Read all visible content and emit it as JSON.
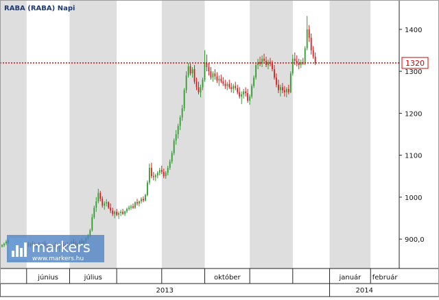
{
  "header": {
    "symbol": "RABA (RABA)",
    "period": "Napi"
  },
  "watermark": {
    "brand": "markers",
    "url": "www.markers.hu"
  },
  "current_price_label": "1320",
  "colors": {
    "up": "#2c9b2c",
    "down": "#d11c1c",
    "price_line": "#dd0000",
    "stripe": "#dedede",
    "axis": "#222222",
    "title": "#1f3b6e",
    "watermark_bg": "#4f82c4"
  },
  "chart_data": {
    "type": "candlestick",
    "title": "RABA (RABA)  Napi",
    "x_unit": "trading day index",
    "y_ticks": [
      {
        "value": 900,
        "label": "900,0"
      },
      {
        "value": 1000,
        "label": "1000"
      },
      {
        "value": 1100,
        "label": "1100"
      },
      {
        "value": 1200,
        "label": "1200"
      },
      {
        "value": 1300,
        "label": "1300"
      },
      {
        "value": 1400,
        "label": "1400"
      }
    ],
    "ylim": [
      830,
      1470
    ],
    "xlim": [
      0,
      195
    ],
    "current_price": 1320,
    "months": [
      {
        "label": "",
        "start": 0
      },
      {
        "label": "június",
        "start": 13
      },
      {
        "label": "július",
        "start": 34
      },
      {
        "label": "",
        "start": 57
      },
      {
        "label": "",
        "start": 79
      },
      {
        "label": "október",
        "start": 100
      },
      {
        "label": "",
        "start": 122
      },
      {
        "label": "",
        "start": 143
      },
      {
        "label": "január",
        "start": 161
      },
      {
        "label": "február",
        "start": 181
      }
    ],
    "years": [
      {
        "label": "2013",
        "start": 0
      },
      {
        "label": "2014",
        "start": 161
      }
    ],
    "ohlc": [
      [
        0,
        880,
        883,
        876,
        878
      ],
      [
        1,
        882,
        888,
        880,
        886
      ],
      [
        2,
        885,
        892,
        881,
        889
      ],
      [
        3,
        890,
        898,
        886,
        894
      ],
      [
        4,
        893,
        899,
        889,
        896
      ],
      [
        5,
        896,
        900,
        889,
        892
      ],
      [
        6,
        890,
        895,
        886,
        893
      ],
      [
        7,
        891,
        899,
        888,
        896
      ],
      [
        8,
        897,
        903,
        893,
        898
      ],
      [
        9,
        898,
        901,
        891,
        894
      ],
      [
        10,
        894,
        898,
        888,
        891
      ],
      [
        11,
        892,
        899,
        888,
        895
      ],
      [
        12,
        897,
        901,
        890,
        892
      ],
      [
        13,
        892,
        897,
        886,
        890
      ],
      [
        14,
        888,
        894,
        881,
        884
      ],
      [
        15,
        884,
        892,
        880,
        889
      ],
      [
        16,
        890,
        895,
        884,
        886
      ],
      [
        17,
        886,
        892,
        880,
        883
      ],
      [
        18,
        882,
        890,
        878,
        888
      ],
      [
        19,
        889,
        893,
        882,
        884
      ],
      [
        20,
        885,
        891,
        879,
        887
      ],
      [
        21,
        886,
        894,
        881,
        891
      ],
      [
        22,
        890,
        896,
        883,
        885
      ],
      [
        23,
        884,
        890,
        876,
        879
      ],
      [
        24,
        879,
        886,
        872,
        883
      ],
      [
        25,
        884,
        889,
        878,
        880
      ],
      [
        26,
        880,
        887,
        873,
        885
      ],
      [
        27,
        886,
        892,
        880,
        882
      ],
      [
        28,
        882,
        888,
        874,
        877
      ],
      [
        29,
        877,
        884,
        870,
        881
      ],
      [
        30,
        882,
        888,
        876,
        886
      ],
      [
        31,
        887,
        893,
        880,
        883
      ],
      [
        32,
        883,
        890,
        877,
        888
      ],
      [
        33,
        887,
        893,
        881,
        884
      ],
      [
        34,
        884,
        890,
        878,
        886
      ],
      [
        35,
        887,
        896,
        882,
        893
      ],
      [
        36,
        893,
        900,
        886,
        889
      ],
      [
        37,
        889,
        895,
        880,
        884
      ],
      [
        38,
        884,
        891,
        878,
        888
      ],
      [
        39,
        889,
        897,
        885,
        894
      ],
      [
        40,
        895,
        901,
        888,
        891
      ],
      [
        41,
        890,
        897,
        884,
        895
      ],
      [
        42,
        896,
        905,
        891,
        902
      ],
      [
        43,
        903,
        912,
        898,
        908
      ],
      [
        44,
        909,
        925,
        905,
        921
      ],
      [
        45,
        921,
        960,
        918,
        952
      ],
      [
        46,
        952,
        980,
        948,
        975
      ],
      [
        47,
        975,
        1000,
        965,
        990
      ],
      [
        48,
        990,
        1020,
        985,
        1010
      ],
      [
        49,
        1010,
        1015,
        990,
        996
      ],
      [
        50,
        996,
        1002,
        975,
        980
      ],
      [
        51,
        980,
        990,
        970,
        985
      ],
      [
        52,
        985,
        995,
        978,
        988
      ],
      [
        53,
        988,
        990,
        972,
        975
      ],
      [
        54,
        975,
        985,
        962,
        968
      ],
      [
        55,
        968,
        975,
        955,
        960
      ],
      [
        56,
        960,
        968,
        950,
        965
      ],
      [
        57,
        965,
        972,
        955,
        958
      ],
      [
        58,
        958,
        966,
        948,
        962
      ],
      [
        59,
        962,
        970,
        955,
        965
      ],
      [
        60,
        965,
        972,
        958,
        960
      ],
      [
        61,
        960,
        968,
        955,
        966
      ],
      [
        62,
        966,
        975,
        962,
        972
      ],
      [
        63,
        972,
        980,
        968,
        975
      ],
      [
        64,
        975,
        982,
        970,
        978
      ],
      [
        65,
        978,
        985,
        972,
        975
      ],
      [
        66,
        975,
        990,
        972,
        988
      ],
      [
        67,
        988,
        996,
        980,
        985
      ],
      [
        68,
        985,
        992,
        978,
        990
      ],
      [
        69,
        990,
        1000,
        985,
        996
      ],
      [
        70,
        996,
        1002,
        988,
        992
      ],
      [
        71,
        992,
        1008,
        990,
        1005
      ],
      [
        72,
        1005,
        1040,
        1002,
        1035
      ],
      [
        73,
        1035,
        1080,
        1030,
        1070
      ],
      [
        74,
        1070,
        1082,
        1045,
        1050
      ],
      [
        75,
        1050,
        1060,
        1040,
        1048
      ],
      [
        76,
        1048,
        1056,
        1038,
        1052
      ],
      [
        77,
        1052,
        1062,
        1045,
        1058
      ],
      [
        78,
        1058,
        1070,
        1052,
        1065
      ],
      [
        79,
        1065,
        1075,
        1055,
        1060
      ],
      [
        80,
        1060,
        1068,
        1045,
        1050
      ],
      [
        81,
        1050,
        1062,
        1044,
        1058
      ],
      [
        82,
        1058,
        1075,
        1052,
        1070
      ],
      [
        83,
        1070,
        1090,
        1065,
        1085
      ],
      [
        84,
        1085,
        1110,
        1080,
        1105
      ],
      [
        85,
        1105,
        1140,
        1100,
        1135
      ],
      [
        86,
        1135,
        1160,
        1125,
        1150
      ],
      [
        87,
        1150,
        1175,
        1140,
        1170
      ],
      [
        88,
        1170,
        1195,
        1160,
        1190
      ],
      [
        89,
        1190,
        1220,
        1182,
        1212
      ],
      [
        90,
        1212,
        1260,
        1205,
        1255
      ],
      [
        91,
        1255,
        1300,
        1248,
        1290
      ],
      [
        92,
        1290,
        1320,
        1285,
        1312
      ],
      [
        93,
        1312,
        1318,
        1290,
        1295
      ],
      [
        94,
        1295,
        1310,
        1285,
        1305
      ],
      [
        95,
        1305,
        1315,
        1270,
        1275
      ],
      [
        96,
        1275,
        1285,
        1255,
        1262
      ],
      [
        97,
        1262,
        1275,
        1245,
        1250
      ],
      [
        98,
        1250,
        1268,
        1238,
        1262
      ],
      [
        99,
        1262,
        1285,
        1255,
        1280
      ],
      [
        100,
        1280,
        1350,
        1275,
        1320
      ],
      [
        101,
        1320,
        1340,
        1300,
        1310
      ],
      [
        102,
        1310,
        1320,
        1290,
        1300
      ],
      [
        103,
        1300,
        1310,
        1280,
        1285
      ],
      [
        104,
        1285,
        1300,
        1275,
        1295
      ],
      [
        105,
        1295,
        1305,
        1280,
        1288
      ],
      [
        106,
        1288,
        1298,
        1272,
        1278
      ],
      [
        107,
        1278,
        1290,
        1265,
        1282
      ],
      [
        108,
        1282,
        1292,
        1272,
        1276
      ],
      [
        109,
        1276,
        1286,
        1265,
        1270
      ],
      [
        110,
        1270,
        1280,
        1258,
        1265
      ],
      [
        111,
        1265,
        1275,
        1255,
        1270
      ],
      [
        112,
        1270,
        1280,
        1258,
        1262
      ],
      [
        113,
        1262,
        1272,
        1250,
        1258
      ],
      [
        114,
        1258,
        1270,
        1248,
        1265
      ],
      [
        115,
        1265,
        1275,
        1255,
        1260
      ],
      [
        116,
        1260,
        1268,
        1245,
        1250
      ],
      [
        117,
        1250,
        1262,
        1235,
        1240
      ],
      [
        118,
        1240,
        1252,
        1222,
        1245
      ],
      [
        119,
        1245,
        1258,
        1235,
        1252
      ],
      [
        120,
        1252,
        1262,
        1240,
        1248
      ],
      [
        121,
        1248,
        1258,
        1225,
        1230
      ],
      [
        122,
        1230,
        1245,
        1220,
        1240
      ],
      [
        123,
        1240,
        1270,
        1235,
        1265
      ],
      [
        124,
        1265,
        1290,
        1260,
        1285
      ],
      [
        125,
        1285,
        1320,
        1280,
        1315
      ],
      [
        126,
        1315,
        1330,
        1305,
        1322
      ],
      [
        127,
        1322,
        1335,
        1312,
        1318
      ],
      [
        128,
        1318,
        1338,
        1310,
        1330
      ],
      [
        129,
        1330,
        1342,
        1318,
        1325
      ],
      [
        130,
        1325,
        1335,
        1310,
        1315
      ],
      [
        131,
        1315,
        1328,
        1305,
        1322
      ],
      [
        132,
        1322,
        1332,
        1312,
        1318
      ],
      [
        133,
        1318,
        1326,
        1300,
        1305
      ],
      [
        134,
        1305,
        1315,
        1280,
        1285
      ],
      [
        135,
        1285,
        1295,
        1262,
        1268
      ],
      [
        136,
        1268,
        1280,
        1248,
        1255
      ],
      [
        137,
        1255,
        1268,
        1240,
        1262
      ],
      [
        138,
        1262,
        1272,
        1248,
        1255
      ],
      [
        139,
        1255,
        1265,
        1240,
        1250
      ],
      [
        140,
        1250,
        1262,
        1238,
        1258
      ],
      [
        141,
        1258,
        1268,
        1245,
        1250
      ],
      [
        142,
        1250,
        1300,
        1248,
        1295
      ],
      [
        143,
        1295,
        1340,
        1290,
        1330
      ],
      [
        144,
        1330,
        1345,
        1315,
        1325
      ],
      [
        145,
        1325,
        1338,
        1312,
        1320
      ],
      [
        146,
        1320,
        1330,
        1305,
        1315
      ],
      [
        147,
        1315,
        1328,
        1308,
        1322
      ],
      [
        148,
        1322,
        1332,
        1315,
        1318
      ],
      [
        149,
        1318,
        1360,
        1315,
        1355
      ],
      [
        150,
        1355,
        1432,
        1350,
        1400
      ],
      [
        151,
        1400,
        1410,
        1370,
        1380
      ],
      [
        152,
        1380,
        1390,
        1340,
        1350
      ],
      [
        153,
        1350,
        1360,
        1330,
        1335
      ],
      [
        154,
        1335,
        1345,
        1315,
        1320
      ]
    ]
  }
}
